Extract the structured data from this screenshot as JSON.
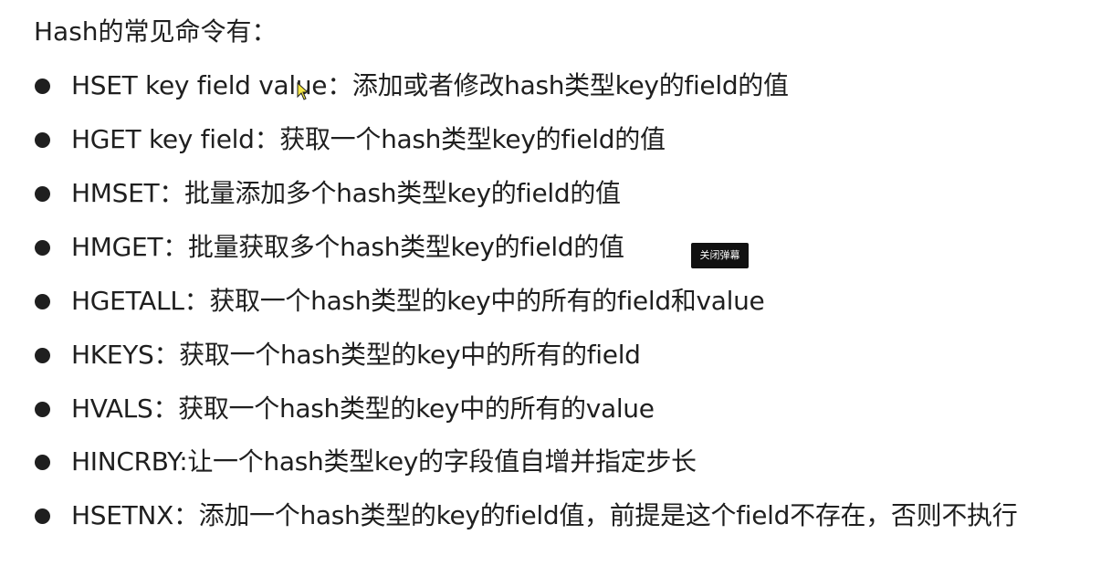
{
  "heading": "Hash的常见命令有：",
  "commands": [
    "HSET key field value：添加或者修改hash类型key的field的值",
    "HGET key field：获取一个hash类型key的field的值",
    "HMSET：批量添加多个hash类型key的field的值",
    "HMGET：批量获取多个hash类型key的field的值",
    "HGETALL：获取一个hash类型的key中的所有的field和value",
    "HKEYS：获取一个hash类型的key中的所有的field",
    "HVALS：获取一个hash类型的key中的所有的value",
    "HINCRBY:让一个hash类型key的字段值自增并指定步长",
    "HSETNX：添加一个hash类型的key的field值，前提是这个field不存在，否则不执行"
  ],
  "overlay": {
    "close_danmaku_label": "关闭弹幕"
  },
  "icons": {
    "cursor": "mouse-pointer-icon"
  }
}
